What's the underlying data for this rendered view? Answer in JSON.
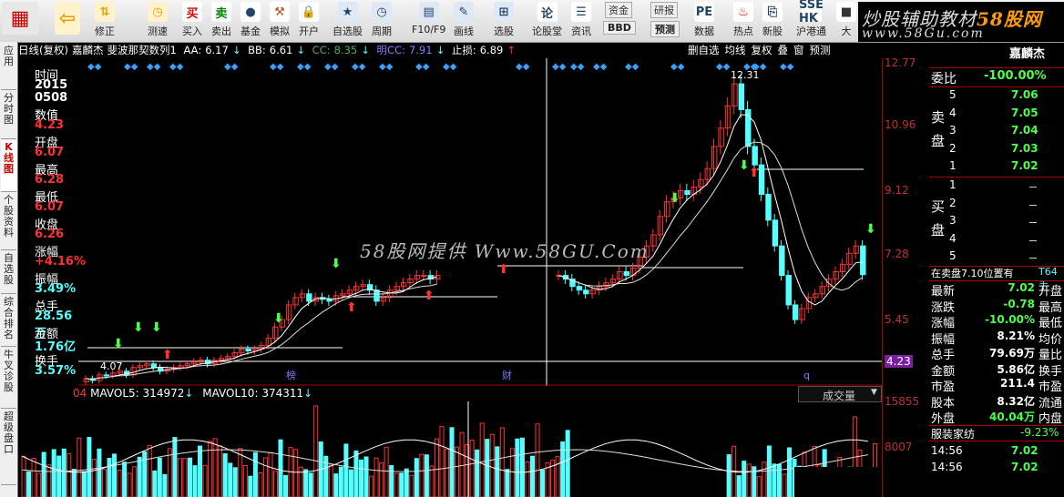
{
  "toolbar": {
    "items": [
      {
        "label": "",
        "icon": "logo-grid-icon"
      },
      {
        "label": "",
        "icon": "back-arrow-icon"
      },
      {
        "label": "修正",
        "icon": "up-down-icon"
      },
      {
        "label": "测速",
        "icon": "clock-icon"
      },
      {
        "label": "买入",
        "icon": "buy-icon",
        "glyph": "买"
      },
      {
        "label": "卖出",
        "icon": "sell-icon",
        "glyph": "卖"
      },
      {
        "label": "基金",
        "icon": "fund-icon"
      },
      {
        "label": "模拟",
        "icon": "hammer-icon"
      },
      {
        "label": "开户",
        "icon": "lock-icon"
      },
      {
        "label": "自选股",
        "icon": "star-icon"
      },
      {
        "label": "周期",
        "icon": "period-icon"
      },
      {
        "label": "F10/F9",
        "icon": "f10-icon"
      },
      {
        "label": "画线",
        "icon": "pencil-icon"
      },
      {
        "label": "选股",
        "icon": "select-stock-icon"
      },
      {
        "label": "论股堂",
        "icon": "forum-icon",
        "glyph": "论"
      },
      {
        "label": "资讯",
        "icon": "news-icon"
      },
      {
        "label": "资金",
        "icon": "capital-icon",
        "glyph": "资金"
      },
      {
        "label": "BBD",
        "icon": "bbd-icon"
      },
      {
        "label": "研报",
        "icon": "research-icon",
        "glyph": "研报"
      },
      {
        "label": "预测",
        "icon": "forecast-icon"
      },
      {
        "label": "数据",
        "icon": "data-icon",
        "glyph": "PE"
      },
      {
        "label": "热点",
        "icon": "hot-icon"
      },
      {
        "label": "新股",
        "icon": "new-stock-icon"
      },
      {
        "label": "沪港通",
        "icon": "hk-connect-icon",
        "glyph": "SSE HK"
      },
      {
        "label": "大",
        "icon": "big-icon"
      }
    ]
  },
  "brand": {
    "line1": "炒股辅助教材",
    "line1_accent": "58股网",
    "line2": "www.58Gu.com"
  },
  "left_tabs": [
    "应用",
    "分时图",
    "K线图",
    "个股资料",
    "自选股",
    "综合排名",
    "牛叉诊股",
    "超级盘口"
  ],
  "header": {
    "title": "日线(复权)",
    "stock_name": "嘉麟杰",
    "indicator": "斐波那契数列1",
    "aa_label": "AA:",
    "aa_value": "6.17",
    "bb_label": "BB:",
    "bb_value": "6.61",
    "cc_label": "CC:",
    "cc_value": "8.35",
    "mcc_label": "明CC:",
    "mcc_value": "7.91",
    "stop_label": "止损:",
    "stop_value": "6.89",
    "right_buttons": [
      "删自选",
      "均线",
      "复权",
      "叠",
      "窗",
      "预测"
    ]
  },
  "info": [
    {
      "label": "时间",
      "value": "2015"
    },
    {
      "label": "",
      "value": "0508"
    },
    {
      "label": "数值",
      "value": "4.23"
    },
    {
      "label": "开盘",
      "value": "6.07"
    },
    {
      "label": "最高",
      "value": "6.28"
    },
    {
      "label": "最低",
      "value": "6.07"
    },
    {
      "label": "收盘",
      "value": "6.26"
    },
    {
      "label": "涨幅",
      "value": "+4.16%"
    },
    {
      "label": "振幅",
      "value": "3.49%"
    },
    {
      "label": "总手",
      "value": "28.56万"
    },
    {
      "label": "金额",
      "value": "1.76亿"
    },
    {
      "label": "换手",
      "value": "3.57%"
    }
  ],
  "price_axis": [
    "12.77",
    "10.96",
    "9.12",
    "7.28",
    "5.45",
    "4.23"
  ],
  "vol_axis": [
    "15855",
    "8007"
  ],
  "chart_annotations": {
    "high_label": "12.31",
    "low_label": "4.07",
    "markers": [
      "榜",
      "财",
      "q"
    ]
  },
  "vol_header": {
    "prefix": "04",
    "ma5_label": "MAVOL5:",
    "ma5_value": "314972",
    "ma10_label": "MAVOL10:",
    "ma10_value": "374311",
    "select": "成交量"
  },
  "watermark": "58股网提供 Www.58GU.Com",
  "rpanel": {
    "top_title": "嘉麟杰",
    "wb_label": "委比",
    "wb_value": "-100.00%",
    "sell_label": "卖盘",
    "sells": [
      {
        "n": "5",
        "p": "7.06"
      },
      {
        "n": "4",
        "p": "7.05"
      },
      {
        "n": "3",
        "p": "7.04"
      },
      {
        "n": "2",
        "p": "7.03"
      },
      {
        "n": "1",
        "p": "7.02"
      }
    ],
    "buy_label": "买盘",
    "buys": [
      {
        "n": "1",
        "p": ""
      },
      {
        "n": "2",
        "p": ""
      },
      {
        "n": "3",
        "p": ""
      },
      {
        "n": "4",
        "p": ""
      },
      {
        "n": "5",
        "p": ""
      }
    ],
    "queue_text": "在卖盘7.10位置有",
    "queue_value": "T64手",
    "stats": [
      {
        "l": "最新",
        "v": "7.02",
        "r": "开盘"
      },
      {
        "l": "涨跌",
        "v": "-0.78",
        "r": "最高"
      },
      {
        "l": "涨幅",
        "v": "-10.00%",
        "r": "最低"
      },
      {
        "l": "振幅",
        "v": "8.21%",
        "r": "均价"
      },
      {
        "l": "总手",
        "v": "79.69万",
        "r": "量比"
      },
      {
        "l": "金额",
        "v": "5.86亿",
        "r": "换手"
      },
      {
        "l": "市盈",
        "v": "211.4",
        "r": "市盈"
      },
      {
        "l": "股本",
        "v": "8.32亿",
        "r": "流通"
      },
      {
        "l": "外盘",
        "v": "40.04万",
        "r": "内盘"
      }
    ],
    "industry": "服装家纺",
    "industry_chg": "-9.23%",
    "ticks": [
      {
        "t": "14:56",
        "p": "7.02"
      },
      {
        "t": "14:56",
        "p": "7.02"
      }
    ]
  },
  "colors": {
    "up": "#ff3232",
    "down": "#54ffff",
    "ma_white": "#ffffff",
    "axis_red": "#a00000",
    "label_yellow": "#ffd200"
  }
}
